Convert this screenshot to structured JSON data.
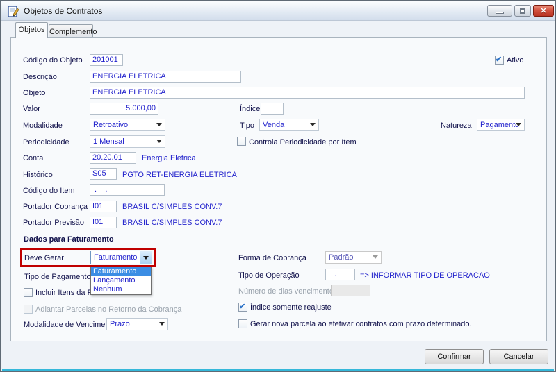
{
  "window": {
    "title": "Objetos de Contratos"
  },
  "tabs": {
    "objetos": "Objetos",
    "complemento": "Complemento"
  },
  "form": {
    "codigo_objeto": {
      "label": "Código do Objeto",
      "value": "201001"
    },
    "ativo": {
      "label": "Ativo",
      "checked": true
    },
    "descricao": {
      "label": "Descrição",
      "value": "ENERGIA ELETRICA"
    },
    "objeto": {
      "label": "Objeto",
      "value": "ENERGIA ELETRICA"
    },
    "valor": {
      "label": "Valor",
      "value": "5.000,00"
    },
    "indice": {
      "label": "Índice",
      "value": ""
    },
    "modalidade": {
      "label": "Modalidade",
      "value": "Retroativo"
    },
    "tipo": {
      "label": "Tipo",
      "value": "Venda"
    },
    "natureza": {
      "label": "Natureza",
      "value": "Pagamento"
    },
    "periodicidade": {
      "label": "Periodicidade",
      "value": "1 Mensal"
    },
    "controla_periodicidade": {
      "label": "Controla Periodicidade por Item",
      "checked": false
    },
    "conta": {
      "label": "Conta",
      "value": "20.20.01",
      "description": "Energia Eletrica"
    },
    "historico": {
      "label": "Histórico",
      "value": "S05",
      "description": "PGTO RET-ENERGIA ELETRICA"
    },
    "codigo_item": {
      "label": "Código do Item",
      "value": " .    . "
    },
    "portador_cobranca": {
      "label": "Portador Cobrança",
      "value": "I01",
      "description": "BRASIL C/SIMPLES CONV.7"
    },
    "portador_previsao": {
      "label": "Portador Previsão",
      "value": "I01",
      "description": "BRASIL C/SIMPLES CONV.7"
    }
  },
  "faturamento": {
    "group_title": "Dados para Faturamento",
    "deve_gerar": {
      "label": "Deve Gerar",
      "value": "Faturamento",
      "options": [
        "Faturamento",
        "Lançamento",
        "Nenhum"
      ],
      "selected_index": 0
    },
    "forma_cobranca": {
      "label": "Forma de Cobrança",
      "value": "Padrão",
      "disabled": true
    },
    "tipo_pagamento": {
      "label": "Tipo de Pagamento"
    },
    "tipo_operacao": {
      "label": "Tipo de Operação",
      "value": "   .",
      "hint": "=> INFORMAR TIPO DE OPERACAO"
    },
    "incluir_itens": {
      "label": "Incluir Itens da Parcela na N",
      "checked": false
    },
    "numero_dias": {
      "label": "Número de dias vencimento",
      "value": "",
      "disabled": true
    },
    "adiantar_parcelas": {
      "label": "Adiantar Parcelas no Retorno da Cobrança",
      "checked": false,
      "disabled": true
    },
    "indice_reajuste": {
      "label": "Índice somente reajuste",
      "checked": true
    },
    "modalidade_vencimento": {
      "label": "Modalidade de Vencimento",
      "value": "Prazo"
    },
    "gerar_nova_parcela": {
      "label": "Gerar nova parcela ao efetivar contratos com prazo determinado.",
      "checked": false
    }
  },
  "buttons": {
    "confirm_accel": "C",
    "confirm_rest": "onfirmar",
    "cancel_pre": "Cancela",
    "cancel_accel": "r"
  },
  "colors": {
    "highlight_red": "#c00000",
    "selection_blue": "#3b8de4",
    "value_text_blue": "#2222cc",
    "label_navy": "#10104a",
    "bottom_accent_cyan": "#35b8da"
  }
}
